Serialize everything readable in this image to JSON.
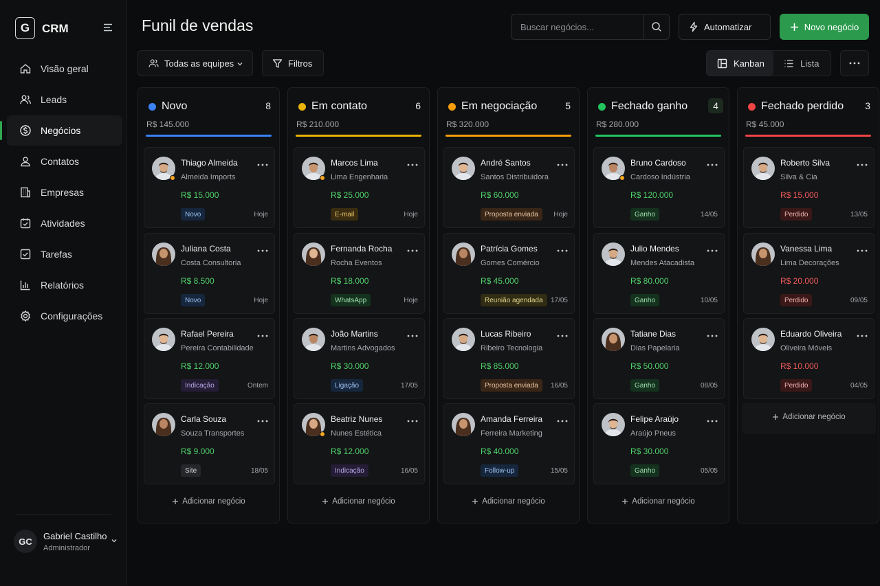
{
  "sidebar": {
    "logo_letter": "G",
    "app_name": "CRM",
    "items": [
      {
        "label": "Visão geral"
      },
      {
        "label": "Leads"
      },
      {
        "label": "Negócios"
      },
      {
        "label": "Contatos"
      },
      {
        "label": "Empresas"
      },
      {
        "label": "Atividades"
      },
      {
        "label": "Tarefas"
      },
      {
        "label": "Relatórios"
      },
      {
        "label": "Configurações"
      }
    ],
    "active_item": "Negócios",
    "user": {
      "initials": "GC",
      "name": "Gabriel Castilho",
      "role": "Administrador"
    }
  },
  "header": {
    "title": "Funil de vendas",
    "search_placeholder": "Buscar negócios...",
    "automate_label": "Automatizar",
    "new_deal_label": "Novo negócio"
  },
  "toolbar": {
    "teams_label": "Todas as equipes",
    "filters_label": "Filtros",
    "view_kanban": "Kanban",
    "view_list": "Lista",
    "active_view": "Kanban"
  },
  "colors": {
    "accent": "#2b9a4c",
    "value_green": "#4fd06a",
    "value_red": "#ef5a5a"
  },
  "add_deal_label": "Adicionar negócio",
  "columns": [
    {
      "title": "Novo",
      "count": "8",
      "total": "R$ 145.000",
      "color": "#3b82f6",
      "cards": [
        {
          "name": "Thiago Almeida",
          "company": "Almeida Imports",
          "value": "R$ 15.000",
          "tag": "Novo",
          "tag_style": "blue",
          "date": "Hoje",
          "dot": "#f5a623",
          "gender": "m"
        },
        {
          "name": "Juliana Costa",
          "company": "Costa Consultoria",
          "value": "R$ 8.500",
          "tag": "Novo",
          "tag_style": "blue",
          "date": "Hoje",
          "dot": "",
          "gender": "f"
        },
        {
          "name": "Rafael Pereira",
          "company": "Pereira Contabilidade",
          "value": "R$ 12.000",
          "tag": "Indicação",
          "tag_style": "purple",
          "date": "Ontem",
          "dot": "",
          "gender": "m"
        },
        {
          "name": "Carla Souza",
          "company": "Souza Transportes",
          "value": "R$ 9.000",
          "tag": "Site",
          "tag_style": "gray",
          "date": "18/05",
          "dot": "",
          "gender": "f"
        }
      ]
    },
    {
      "title": "Em contato",
      "count": "6",
      "total": "R$ 210.000",
      "color": "#eab308",
      "cards": [
        {
          "name": "Marcos Lima",
          "company": "Lima Engenharia",
          "value": "R$ 25.000",
          "tag": "E-mail",
          "tag_style": "amber",
          "date": "Hoje",
          "dot": "#f5a623",
          "gender": "m"
        },
        {
          "name": "Fernanda Rocha",
          "company": "Rocha Eventos",
          "value": "R$ 18.000",
          "tag": "WhatsApp",
          "tag_style": "green",
          "date": "Hoje",
          "dot": "",
          "gender": "f"
        },
        {
          "name": "João Martins",
          "company": "Martins Advogados",
          "value": "R$ 30.000",
          "tag": "Ligação",
          "tag_style": "blue",
          "date": "17/05",
          "dot": "",
          "gender": "m"
        },
        {
          "name": "Beatriz Nunes",
          "company": "Nunes Estética",
          "value": "R$ 12.000",
          "tag": "Indicação",
          "tag_style": "purple",
          "date": "16/05",
          "dot": "#f5a623",
          "gender": "f"
        }
      ]
    },
    {
      "title": "Em negociação",
      "count": "5",
      "total": "R$ 320.000",
      "color": "#f59e0b",
      "cards": [
        {
          "name": "André Santos",
          "company": "Santos Distribuidora",
          "value": "R$ 60.000",
          "tag": "Proposta enviada",
          "tag_style": "brown",
          "date": "Hoje",
          "dot": "",
          "gender": "m"
        },
        {
          "name": "Patrícia Gomes",
          "company": "Gomes Comércio",
          "value": "R$ 45.000",
          "tag": "Reunião agendada",
          "tag_style": "olive",
          "date": "17/05",
          "dot": "",
          "gender": "f"
        },
        {
          "name": "Lucas Ribeiro",
          "company": "Ribeiro Tecnologia",
          "value": "R$ 85.000",
          "tag": "Proposta enviada",
          "tag_style": "brown",
          "date": "16/05",
          "dot": "",
          "gender": "m"
        },
        {
          "name": "Amanda Ferreira",
          "company": "Ferreira Marketing",
          "value": "R$ 40.000",
          "tag": "Follow-up",
          "tag_style": "blue",
          "date": "15/05",
          "dot": "",
          "gender": "f"
        }
      ]
    },
    {
      "title": "Fechado ganho",
      "count": "4",
      "total": "R$ 280.000",
      "color": "#22c55e",
      "cards": [
        {
          "name": "Bruno Cardoso",
          "company": "Cardoso Indústria",
          "value": "R$ 120.000",
          "tag": "Ganho",
          "tag_style": "green",
          "date": "14/05",
          "dot": "#f5a623",
          "gender": "m"
        },
        {
          "name": "Julio Mendes",
          "company": "Mendes Atacadista",
          "value": "R$ 80.000",
          "tag": "Ganho",
          "tag_style": "green",
          "date": "10/05",
          "dot": "",
          "gender": "m"
        },
        {
          "name": "Tatiane Dias",
          "company": "Dias Papelaria",
          "value": "R$ 50.000",
          "tag": "Ganho",
          "tag_style": "green",
          "date": "08/05",
          "dot": "",
          "gender": "f"
        },
        {
          "name": "Felipe Araújo",
          "company": "Araújo Pneus",
          "value": "R$ 30.000",
          "tag": "Ganho",
          "tag_style": "green",
          "date": "05/05",
          "dot": "",
          "gender": "m"
        }
      ]
    },
    {
      "title": "Fechado perdido",
      "count": "3",
      "total": "R$ 45.000",
      "color": "#ef4444",
      "cards": [
        {
          "name": "Roberto Silva",
          "company": "Silva & Cia",
          "value": "R$ 15.000",
          "tag": "Perdido",
          "tag_style": "red",
          "date": "13/05",
          "dot": "",
          "gender": "m"
        },
        {
          "name": "Vanessa Lima",
          "company": "Lima Decorações",
          "value": "R$ 20.000",
          "tag": "Perdido",
          "tag_style": "red",
          "date": "09/05",
          "dot": "",
          "gender": "f"
        },
        {
          "name": "Eduardo Oliveira",
          "company": "Oliveira Móveis",
          "value": "R$ 10.000",
          "tag": "Perdido",
          "tag_style": "red",
          "date": "04/05",
          "dot": "",
          "gender": "m"
        }
      ]
    }
  ]
}
